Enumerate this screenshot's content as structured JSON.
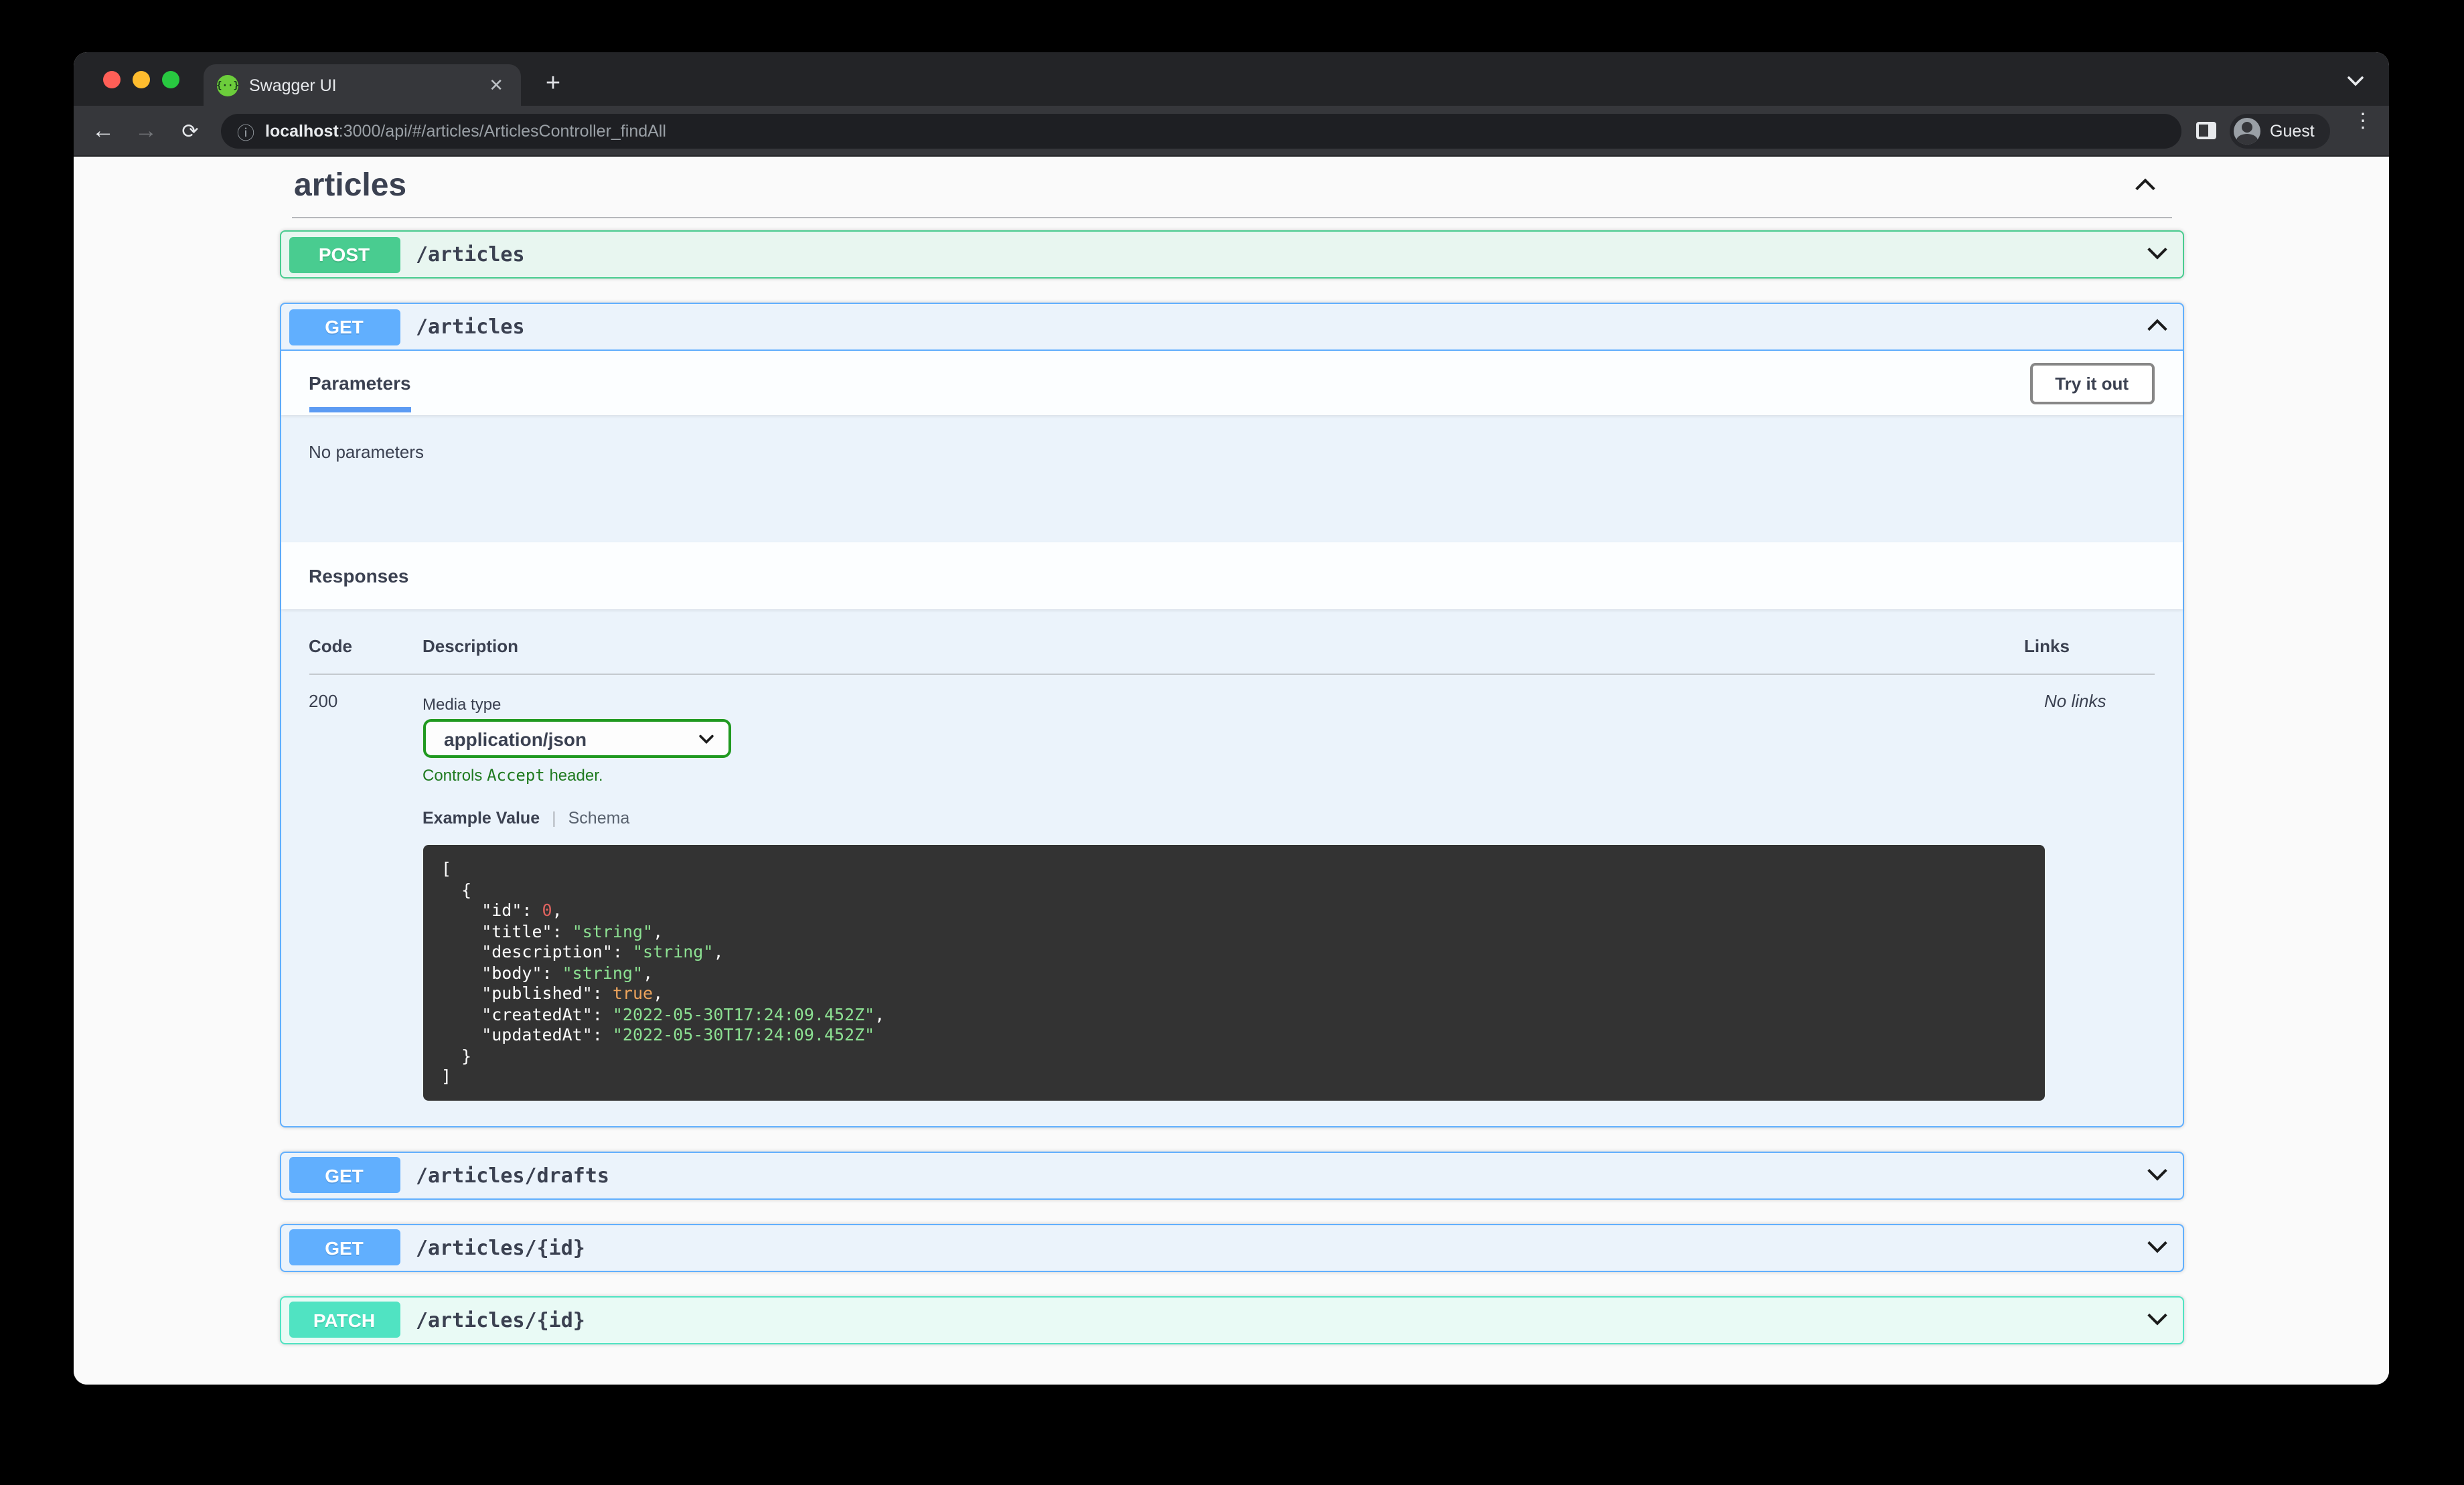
{
  "browser": {
    "tab_title": "Swagger UI",
    "new_tab_label": "+",
    "close_tab_label": "✕",
    "url": {
      "host": "localhost",
      "rest": ":3000/api/#/articles/ArticlesController_findAll"
    },
    "profile_label": "Guest"
  },
  "colors": {
    "get_blue": "#61affe",
    "post_green": "#49cc90",
    "patch_teal": "#50e3c2",
    "text": "#3b4151",
    "select_border_green": "#209920",
    "accept_note_green": "#1f7a1f",
    "code_bg": "#333333",
    "code_string": "#8ce092",
    "code_number": "#e0635f",
    "code_boolean": "#eda45c"
  },
  "tag": {
    "title": "articles"
  },
  "operations": [
    {
      "method": "POST",
      "path": "/articles",
      "type": "post",
      "state": "collapsed"
    },
    {
      "method": "GET",
      "path": "/articles",
      "type": "get",
      "state": "expanded"
    },
    {
      "method": "GET",
      "path": "/articles/drafts",
      "type": "get",
      "state": "collapsed"
    },
    {
      "method": "GET",
      "path": "/articles/{id}",
      "type": "get",
      "state": "collapsed"
    },
    {
      "method": "PATCH",
      "path": "/articles/{id}",
      "type": "patch",
      "state": "collapsed"
    }
  ],
  "get_detail": {
    "parameters_title": "Parameters",
    "try_it_out": "Try it out",
    "no_parameters": "No parameters",
    "responses_title": "Responses",
    "columns": {
      "code": "Code",
      "description": "Description",
      "links": "Links"
    },
    "response": {
      "code": "200",
      "links": "No links"
    },
    "media_type_label": "Media type",
    "media_type_value": "application/json",
    "accept_parts": [
      "Controls ",
      "Accept",
      " header."
    ],
    "tabs": {
      "example": "Example Value",
      "schema": "Schema"
    }
  },
  "example_lines": [
    [
      {
        "t": "[",
        "c": "plain"
      }
    ],
    [
      {
        "t": "  {",
        "c": "plain"
      }
    ],
    [
      {
        "t": "    \"id\": ",
        "c": "plain"
      },
      {
        "t": "0",
        "c": "num"
      },
      {
        "t": ",",
        "c": "plain"
      }
    ],
    [
      {
        "t": "    \"title\": ",
        "c": "plain"
      },
      {
        "t": "\"string\"",
        "c": "str"
      },
      {
        "t": ",",
        "c": "plain"
      }
    ],
    [
      {
        "t": "    \"description\": ",
        "c": "plain"
      },
      {
        "t": "\"string\"",
        "c": "str"
      },
      {
        "t": ",",
        "c": "plain"
      }
    ],
    [
      {
        "t": "    \"body\": ",
        "c": "plain"
      },
      {
        "t": "\"string\"",
        "c": "str"
      },
      {
        "t": ",",
        "c": "plain"
      }
    ],
    [
      {
        "t": "    \"published\": ",
        "c": "plain"
      },
      {
        "t": "true",
        "c": "bool"
      },
      {
        "t": ",",
        "c": "plain"
      }
    ],
    [
      {
        "t": "    \"createdAt\": ",
        "c": "plain"
      },
      {
        "t": "\"2022-05-30T17:24:09.452Z\"",
        "c": "str"
      },
      {
        "t": ",",
        "c": "plain"
      }
    ],
    [
      {
        "t": "    \"updatedAt\": ",
        "c": "plain"
      },
      {
        "t": "\"2022-05-30T17:24:09.452Z\"",
        "c": "str"
      }
    ],
    [
      {
        "t": "  }",
        "c": "plain"
      }
    ],
    [
      {
        "t": "]",
        "c": "plain"
      }
    ]
  ]
}
